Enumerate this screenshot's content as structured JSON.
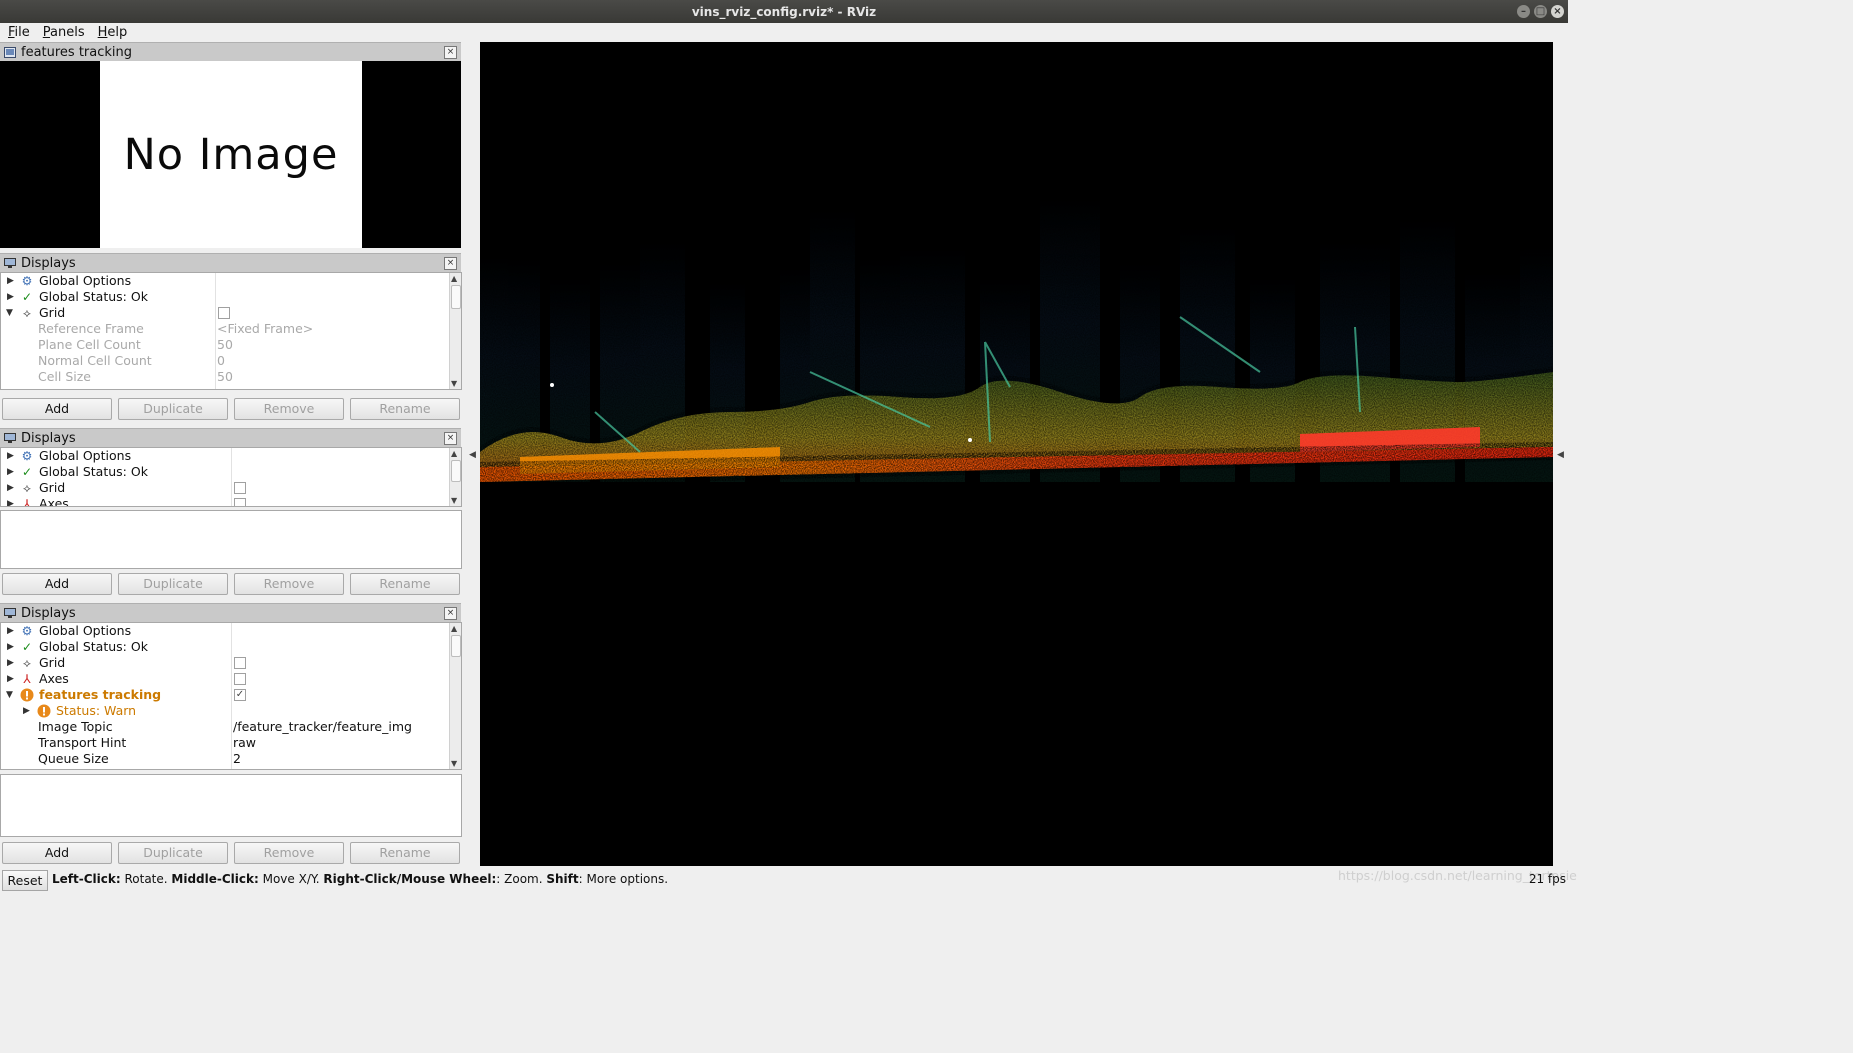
{
  "window": {
    "title": "vins_rviz_config.rviz* - RViz"
  },
  "menu": [
    {
      "label": "File",
      "accel": "F",
      "rest": "ile"
    },
    {
      "label": "Panels",
      "accel": "P",
      "rest": "anels"
    },
    {
      "label": "Help",
      "accel": "H",
      "rest": "elp"
    }
  ],
  "image_panel": {
    "title": "features tracking",
    "placeholder_text": "No Image"
  },
  "displays_panel_1": {
    "title": "Displays",
    "rows": {
      "global_options": "Global Options",
      "global_status": "Global Status: Ok",
      "grid": "Grid",
      "reference_frame": {
        "name": "Reference Frame",
        "value": "<Fixed Frame>"
      },
      "plane_cell_count": {
        "name": "Plane Cell Count",
        "value": "50"
      },
      "normal_cell_count": {
        "name": "Normal Cell Count",
        "value": "0"
      },
      "cell_size": {
        "name": "Cell Size",
        "value": "50"
      }
    }
  },
  "displays_panel_2": {
    "title": "Displays",
    "rows": {
      "global_options": "Global Options",
      "global_status": "Global Status: Ok",
      "grid": "Grid",
      "axes": "Axes"
    }
  },
  "displays_panel_3": {
    "title": "Displays",
    "rows": {
      "global_options": "Global Options",
      "global_status": "Global Status: Ok",
      "grid": "Grid",
      "axes": "Axes",
      "features_tracking": "features tracking",
      "status_warn": "Status: Warn",
      "image_topic": {
        "name": "Image Topic",
        "value": "/feature_tracker/feature_img"
      },
      "transport_hint": {
        "name": "Transport Hint",
        "value": "raw"
      },
      "queue_size": {
        "name": "Queue Size",
        "value": "2"
      }
    }
  },
  "buttons": {
    "add": "Add",
    "duplicate": "Duplicate",
    "remove": "Remove",
    "rename": "Rename"
  },
  "statusbar": {
    "reset": "Reset",
    "left_click": "Left-Click:",
    "left_click_desc": " Rotate. ",
    "middle_click": "Middle-Click:",
    "middle_click_desc": " Move X/Y. ",
    "right_click": "Right-Click/Mouse Wheel:",
    "right_click_desc": ": Zoom. ",
    "shift": "Shift",
    "shift_desc": ": More options.",
    "watermark": "https://blog.csdn.net/learning_tortosie",
    "fps": "21 fps"
  },
  "colors": {
    "warn": "#cc7a00",
    "ok_check": "#1a8c1a",
    "titlebar": "#3c3c3a",
    "view_bg": "#000000"
  }
}
